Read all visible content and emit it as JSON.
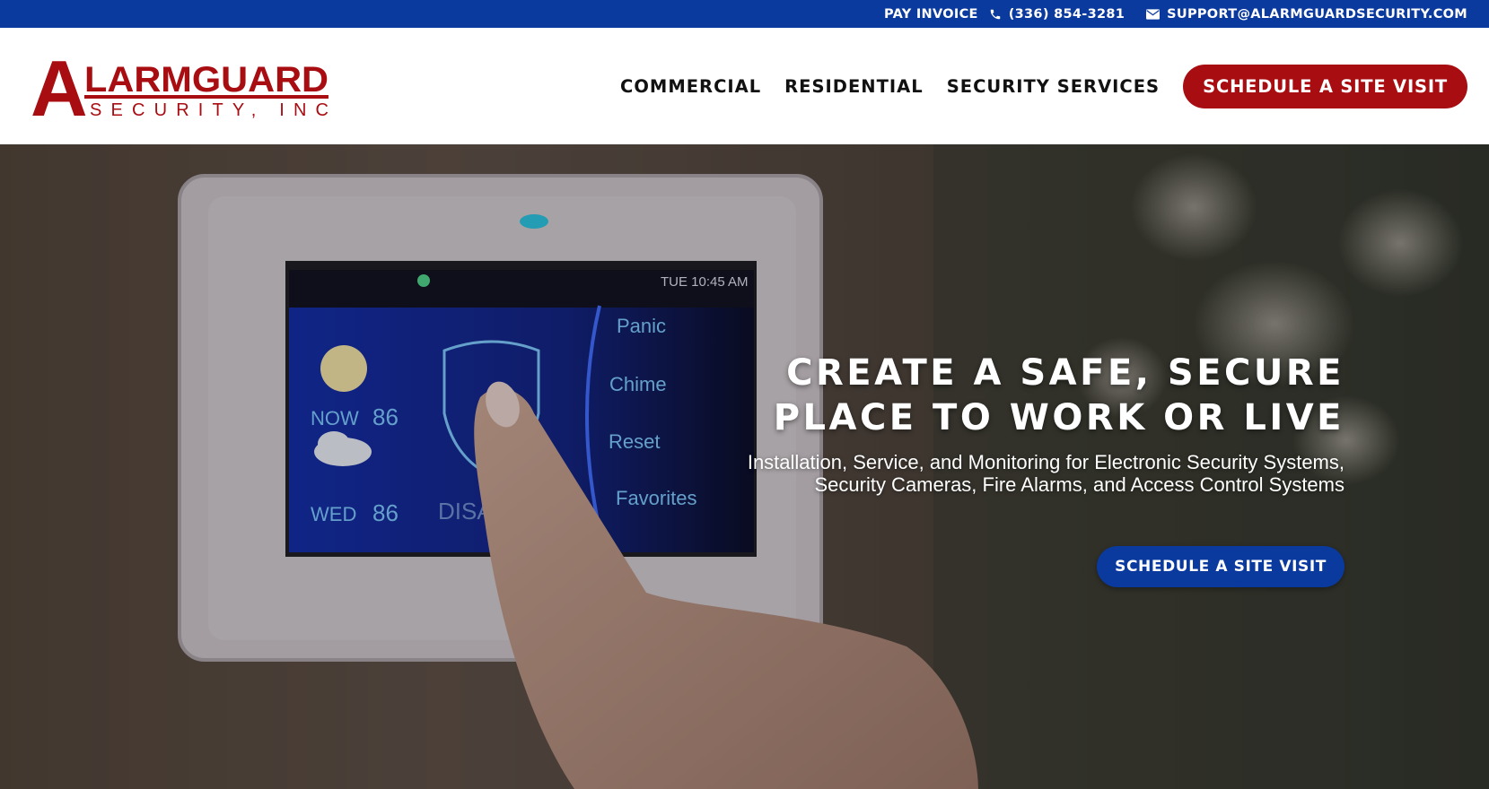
{
  "topbar": {
    "pay_invoice": "PAY INVOICE",
    "phone": "(336) 854-3281",
    "email": "SUPPORT@ALARMGUARDSECURITY.COM",
    "phone_icon": "phone-icon",
    "email_icon": "envelope-icon"
  },
  "logo": {
    "initial": "A",
    "name": "LARMGUARD",
    "tagline": "SECURITY, INC"
  },
  "nav": {
    "items": [
      {
        "label": "COMMERCIAL"
      },
      {
        "label": "RESIDENTIAL"
      },
      {
        "label": "SECURITY SERVICES"
      }
    ],
    "cta": "SCHEDULE A SITE VISIT"
  },
  "hero": {
    "title_line1": "CREATE A SAFE, SECURE",
    "title_line2": "PLACE TO WORK OR LIVE",
    "subtitle_line1": "Installation, Service, and Monitoring for Electronic Security Systems,",
    "subtitle_line2": "Security Cameras, Fire Alarms, and Access Control Systems",
    "cta": "SCHEDULE A SITE VISIT"
  },
  "panel_screen": {
    "time": "TUE 10:45 AM",
    "now_label": "NOW",
    "now_temp": "86",
    "wed_label": "WED",
    "wed_temp": "86",
    "disarm": "DISARM",
    "menu": [
      "Panic",
      "Chime",
      "Reset",
      "Favorites"
    ]
  },
  "colors": {
    "brand_blue": "#0b3a9e",
    "brand_red": "#a80d12"
  }
}
